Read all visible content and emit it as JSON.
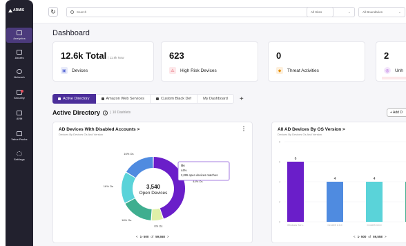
{
  "sidebar": {
    "logo": "ARMIS",
    "items": [
      {
        "label": "Analytics",
        "icon": "analytics-icon"
      },
      {
        "label": "Assets",
        "icon": "assets-icon"
      },
      {
        "label": "Network",
        "icon": "network-icon"
      },
      {
        "label": "Security",
        "icon": "security-icon"
      },
      {
        "label": "AVM",
        "icon": "avm-icon"
      },
      {
        "label": "Value Packs",
        "icon": "value-packs-icon"
      },
      {
        "label": "Settings",
        "icon": "settings-icon"
      }
    ]
  },
  "topbar": {
    "search_placeholder": "Search",
    "sites": "All Sites",
    "boundaries": "All Boundaries"
  },
  "page_title": "Dashboard",
  "stats": [
    {
      "value": "12.6k Total",
      "sub": "| 11.9k Now",
      "label": "Devices",
      "icon": "device-icon",
      "color": "#5b6bd6",
      "bg": "#e8ebfa"
    },
    {
      "value": "623",
      "sub": "",
      "label": "High Risk Devices",
      "icon": "warning-icon",
      "color": "#e14b5a",
      "bg": "#fde8ea"
    },
    {
      "value": "0",
      "sub": "",
      "label": "Threat Activities",
      "icon": "threat-icon",
      "color": "#e8900c",
      "bg": "#fdf0dd"
    },
    {
      "value": "2",
      "sub": "",
      "label": "Unh",
      "icon": "bell-icon",
      "color": "#a54bd6",
      "bg": "#f3e6fb"
    }
  ],
  "tabs": [
    {
      "label": "Active Directory",
      "locked": true
    },
    {
      "label": "Amazon Web Services",
      "locked": true
    },
    {
      "label": "Custom Black Def",
      "locked": true
    },
    {
      "label": "My Dashboard",
      "locked": false
    }
  ],
  "tabs_plus": "+",
  "section": {
    "title": "Active Directory",
    "info": "i",
    "sub": "| 10 Dashlets",
    "add_label": "+ Add D"
  },
  "left_panel": {
    "title": "AD Devices With Disabled Accounts >",
    "subtitle": "Devices By Devices Os And Version",
    "kebab": "⋮",
    "center_value": "3,540",
    "center_label": "Open Devices",
    "tooltip": {
      "title": "Os",
      "line1": "44%",
      "line2": "2,095 open devices matches"
    },
    "pager": {
      "prev": "<",
      "range": "1- 500",
      "of": "of",
      "total": "59,558",
      "next": ">"
    }
  },
  "right_panel": {
    "title": "All AD Devices By OS Version >",
    "subtitle": "Devices By Devices Os And Version",
    "pager": {
      "prev": "<",
      "range": "1- 500",
      "of": "of",
      "total": "59,558",
      "next": ">"
    }
  },
  "chart_data": [
    {
      "type": "pie",
      "categories": [
        "Os",
        "Os",
        "Os",
        "Os",
        "Os"
      ],
      "labels": [
        "44% Os",
        "6% Os",
        "16% Os",
        "16% Os",
        "16% Os"
      ],
      "values": [
        44,
        6,
        16,
        16,
        16
      ],
      "colors": [
        "#6a1ec9",
        "#dff0a8",
        "#3fae8f",
        "#5ad3d9",
        "#4f8be0"
      ]
    },
    {
      "type": "bar",
      "categories": [
        "Windows Serv..",
        "CentOS 2.0.0",
        "CentOS 3.0.0",
        ""
      ],
      "values": [
        6,
        4,
        4,
        4
      ],
      "colors": [
        "#6a1ec9",
        "#4f8be0",
        "#5ad3d9",
        "#3fae8f"
      ],
      "ylim": [
        0,
        8
      ],
      "yticks": [
        "8",
        "6",
        "4",
        "2",
        "0"
      ]
    }
  ]
}
